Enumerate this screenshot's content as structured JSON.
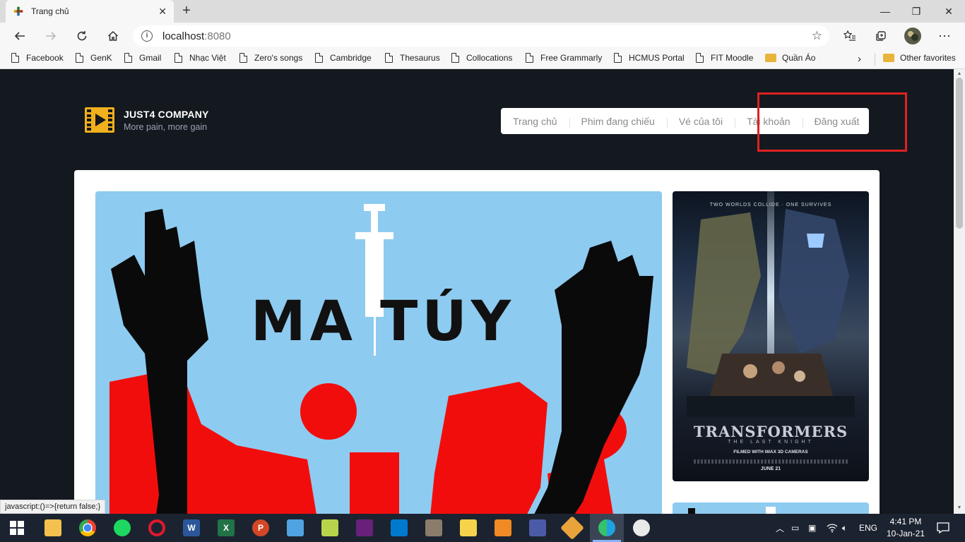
{
  "browser": {
    "tab_title": "Trang chủ",
    "url_host": "localhost",
    "url_port": ":8080",
    "bookmarks": [
      "Facebook",
      "GenK",
      "Gmail",
      "Nhạc Việt",
      "Zero's songs",
      "Cambridge",
      "Thesaurus",
      "Collocations",
      "Free Grammarly",
      "HCMUS Portal",
      "FIT Moodle",
      "Quần Áo"
    ],
    "other_favorites": "Other favorites",
    "status_url": "javascript:()=>{return false;}"
  },
  "site": {
    "brand_name": "JUST4 COMPANY",
    "brand_tagline": "More pain, more gain",
    "menu": [
      "Trang chủ",
      "Phim đang chiếu",
      "Vé của tôi",
      "Tài khoản",
      "Đăng xuất"
    ]
  },
  "hero": {
    "title": "MA TÚY"
  },
  "poster": {
    "tagline": "TWO WORLDS COLLIDE · ONE SURVIVES",
    "title": "TRANSFORMERS",
    "subtitle": "THE LAST KNIGHT",
    "format": "FILMED WITH IMAX 3D CAMERAS",
    "date": "JUNE 21"
  },
  "taskbar": {
    "language": "ENG",
    "time": "4:41 PM",
    "date": "10-Jan-21"
  },
  "colors": {
    "page_bg": "#14181f",
    "accent_yellow": "#f1b01d",
    "highlight_red": "#e02121",
    "hero_blue": "#8ecbf0",
    "aids_red": "#f20d0d"
  }
}
